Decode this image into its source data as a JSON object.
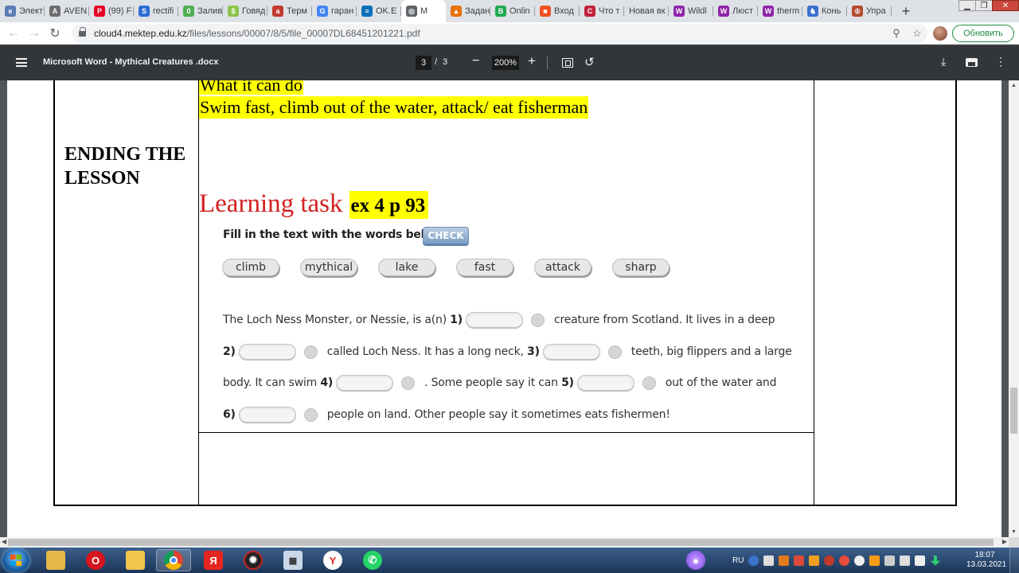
{
  "browser": {
    "tabs": [
      {
        "title": "Элект",
        "fav_color": "#5a7bb5",
        "fav_glyph": "e"
      },
      {
        "title": "AVEN",
        "fav_color": "#6d6d6d",
        "fav_glyph": "A"
      },
      {
        "title": "(99) F",
        "fav_color": "#e60023",
        "fav_glyph": "P"
      },
      {
        "title": "rectifi",
        "fav_color": "#2b6cd3",
        "fav_glyph": "S"
      },
      {
        "title": "Залив",
        "fav_color": "#4caf50",
        "fav_glyph": "0"
      },
      {
        "title": "Говяд",
        "fav_color": "#8bc34a",
        "fav_glyph": "$"
      },
      {
        "title": "Терм",
        "fav_color": "#c0392b",
        "fav_glyph": "a"
      },
      {
        "title": "гаран",
        "fav_color": "#4285f4",
        "fav_glyph": "G"
      },
      {
        "title": "OK.E",
        "fav_color": "#0a6fb8",
        "fav_glyph": "≡"
      },
      {
        "title": "M",
        "fav_color": "#5f6368",
        "fav_glyph": "◎",
        "active": true
      },
      {
        "title": "Задан",
        "fav_color": "#e8710a",
        "fav_glyph": "▲"
      },
      {
        "title": "Onlin",
        "fav_color": "#1fa84f",
        "fav_glyph": "B"
      },
      {
        "title": "Вход",
        "fav_color": "#f25022",
        "fav_glyph": "■"
      },
      {
        "title": "Что т",
        "fav_color": "#c0213b",
        "fav_glyph": "C"
      },
      {
        "title": "Новая вк",
        "fav_color": "",
        "fav_glyph": ""
      },
      {
        "title": "Wildl",
        "fav_color": "#8e24aa",
        "fav_glyph": "W"
      },
      {
        "title": "Люст",
        "fav_color": "#8e24aa",
        "fav_glyph": "W"
      },
      {
        "title": "therm",
        "fav_color": "#8e24aa",
        "fav_glyph": "W"
      },
      {
        "title": "Конь",
        "fav_color": "#3b6fd1",
        "fav_glyph": "♞"
      },
      {
        "title": "Упра",
        "fav_color": "#b34a2e",
        "fav_glyph": "♔"
      }
    ],
    "new_tab_label": "+",
    "url_host": "cloud4.mektep.edu.kz",
    "url_path": "/files/lessons/00007/8/5/file_00007DL68451201221.pdf",
    "update_label": "Обновить"
  },
  "pdf_toolbar": {
    "doc_title": "Microsoft Word - Mythical Creatures .docx",
    "current_page": "3",
    "page_separator": "/",
    "total_pages": "3",
    "zoom": "200%"
  },
  "document": {
    "what_heading": "What it can do",
    "swim_line": "Swim fast, climb out of the water, attack/ eat fisherman",
    "ending_line1": "ENDING THE",
    "ending_line2": "LESSON",
    "task_label": "Learning task",
    "task_ref": "ex 4 p 93",
    "exercise": {
      "instruction": "Fill in the text with the words below.",
      "check_label": "CHECK",
      "words": [
        "climb",
        "mythical",
        "lake",
        "fast",
        "attack",
        "sharp"
      ],
      "line1": {
        "pre": "The Loch Ness Monster, or Nessie, is a(n)",
        "num1": "1)",
        "post": "creature from Scotland. It lives in a deep"
      },
      "line2": {
        "num2": "2)",
        "mid": "called Loch Ness. It has a long neck,",
        "num3": "3)",
        "post": "teeth, big flippers and a large"
      },
      "line3": {
        "pre": "body. It can swim",
        "num4": "4)",
        "mid": ". Some people say it can",
        "num5": "5)",
        "post": "out of the water and"
      },
      "line4": {
        "num6": "6)",
        "post": "people on land. Other people say it sometimes eats fishermen!"
      }
    }
  },
  "taskbar": {
    "lang": "RU",
    "time": "18:07",
    "date": "13.03.2021"
  }
}
